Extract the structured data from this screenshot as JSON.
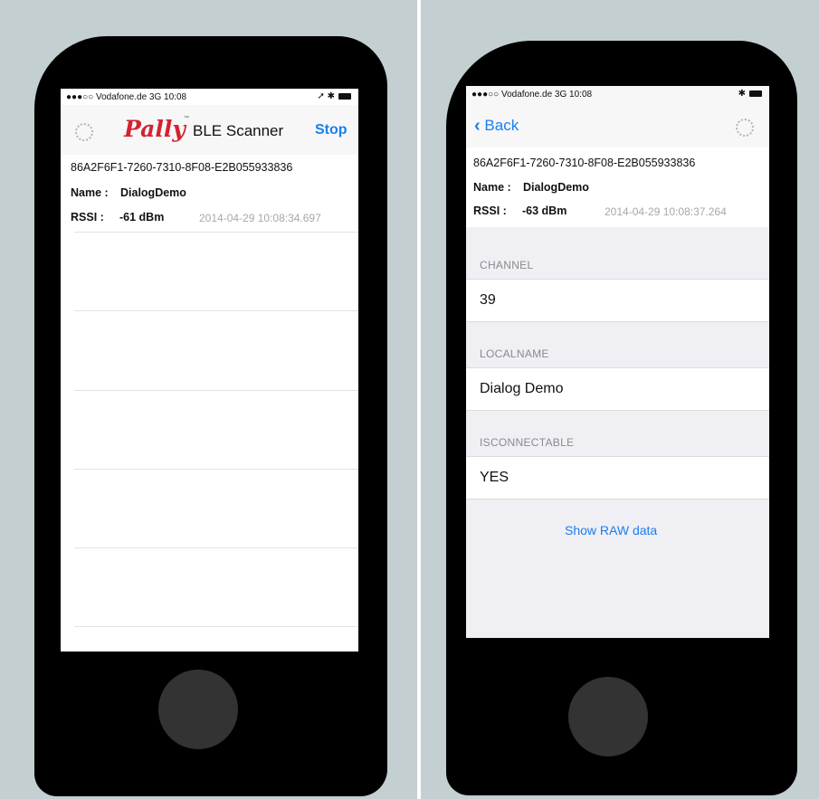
{
  "left": {
    "status_bar": {
      "carrier": "●●●○○ Vodafone.de  3G  10:08",
      "right": "➚ ✱"
    },
    "nav": {
      "logo": "Pally",
      "tm": "™",
      "title": "BLE Scanner",
      "stop": "Stop"
    },
    "device": {
      "uuid": "86A2F6F1-7260-7310-8F08-E2B055933836",
      "name_label": "Name :",
      "name": "DialogDemo",
      "rssi_label": "RSSI :",
      "rssi": "-61 dBm",
      "timestamp": "2014-04-29 10:08:34.697"
    }
  },
  "right": {
    "status_bar": {
      "carrier": "●●●○○ Vodafone.de  3G  10:08",
      "right": "✱"
    },
    "nav": {
      "back": "Back"
    },
    "device": {
      "uuid": "86A2F6F1-7260-7310-8F08-E2B055933836",
      "name_label": "Name :",
      "name": "DialogDemo",
      "rssi_label": "RSSI :",
      "rssi": "-63 dBm",
      "timestamp": "2014-04-29 10:08:37.264"
    },
    "sections": [
      {
        "header": "CHANNEL",
        "value": "39"
      },
      {
        "header": "LOCALNAME",
        "value": "Dialog Demo"
      },
      {
        "header": "ISCONNECTABLE",
        "value": "YES"
      }
    ],
    "raw_link": "Show RAW data"
  },
  "colors": {
    "background": "#c3cfd0",
    "phone": "#000000",
    "accent": "#1a7ff0",
    "logo": "#d42230"
  }
}
